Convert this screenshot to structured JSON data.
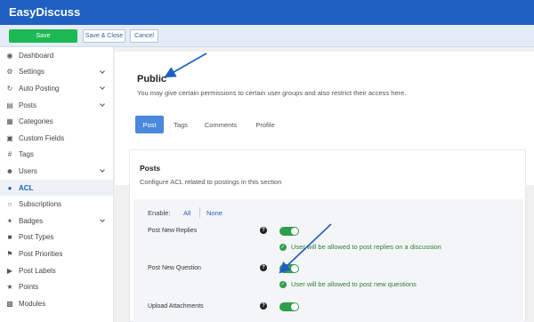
{
  "app": {
    "title": "EasyDiscuss"
  },
  "toolbar": {
    "save": "Save",
    "save_close": "Save & Close",
    "cancel": "Cancel"
  },
  "sidebar": {
    "items": [
      {
        "label": "Dashboard",
        "icon": "dashboard-icon",
        "expandable": false
      },
      {
        "label": "Settings",
        "icon": "gear-icon",
        "expandable": true
      },
      {
        "label": "Auto Posting",
        "icon": "refresh-icon",
        "expandable": true
      },
      {
        "label": "Posts",
        "icon": "document-icon",
        "expandable": true
      },
      {
        "label": "Categories",
        "icon": "categories-icon",
        "expandable": false
      },
      {
        "label": "Custom Fields",
        "icon": "custom-fields-icon",
        "expandable": false
      },
      {
        "label": "Tags",
        "icon": "hash-icon",
        "expandable": false
      },
      {
        "label": "Users",
        "icon": "user-icon",
        "expandable": true
      },
      {
        "label": "ACL",
        "icon": "users-icon",
        "expandable": false,
        "active": true
      },
      {
        "label": "Subscriptions",
        "icon": "subscriptions-icon",
        "expandable": false
      },
      {
        "label": "Badges",
        "icon": "badge-icon",
        "expandable": true
      },
      {
        "label": "Post Types",
        "icon": "post-types-icon",
        "expandable": false
      },
      {
        "label": "Post Priorities",
        "icon": "flag-icon",
        "expandable": false
      },
      {
        "label": "Post Labels",
        "icon": "label-icon",
        "expandable": false
      },
      {
        "label": "Points",
        "icon": "points-icon",
        "expandable": false
      },
      {
        "label": "Modules",
        "icon": "modules-icon",
        "expandable": false
      }
    ]
  },
  "header": {
    "title": "Public",
    "description": "You may give certain permissions to certain user groups and also restrict their access here.",
    "tabs": [
      {
        "label": "Post",
        "active": true
      },
      {
        "label": "Tags"
      },
      {
        "label": "Comments"
      },
      {
        "label": "Profile"
      }
    ]
  },
  "section": {
    "title": "Posts",
    "description": "Configure ACL related to postings in this section",
    "enable_label": "Enable:",
    "enable_all": "All",
    "enable_none": "None",
    "permissions": [
      {
        "label": "Post New Replies",
        "enabled": true,
        "note": "User will be allowed to post replies on a discussion"
      },
      {
        "label": "Post New Question",
        "enabled": true,
        "note": "User will be allowed to post new questions"
      },
      {
        "label": "Upload Attachments",
        "enabled": true,
        "note": ""
      }
    ]
  },
  "colors": {
    "topbar": "#1e5fc2",
    "save": "#1db954",
    "toggle_on": "#2e9e4b",
    "active_tab": "#4a89dc",
    "arrow": "#1e5fc2"
  }
}
